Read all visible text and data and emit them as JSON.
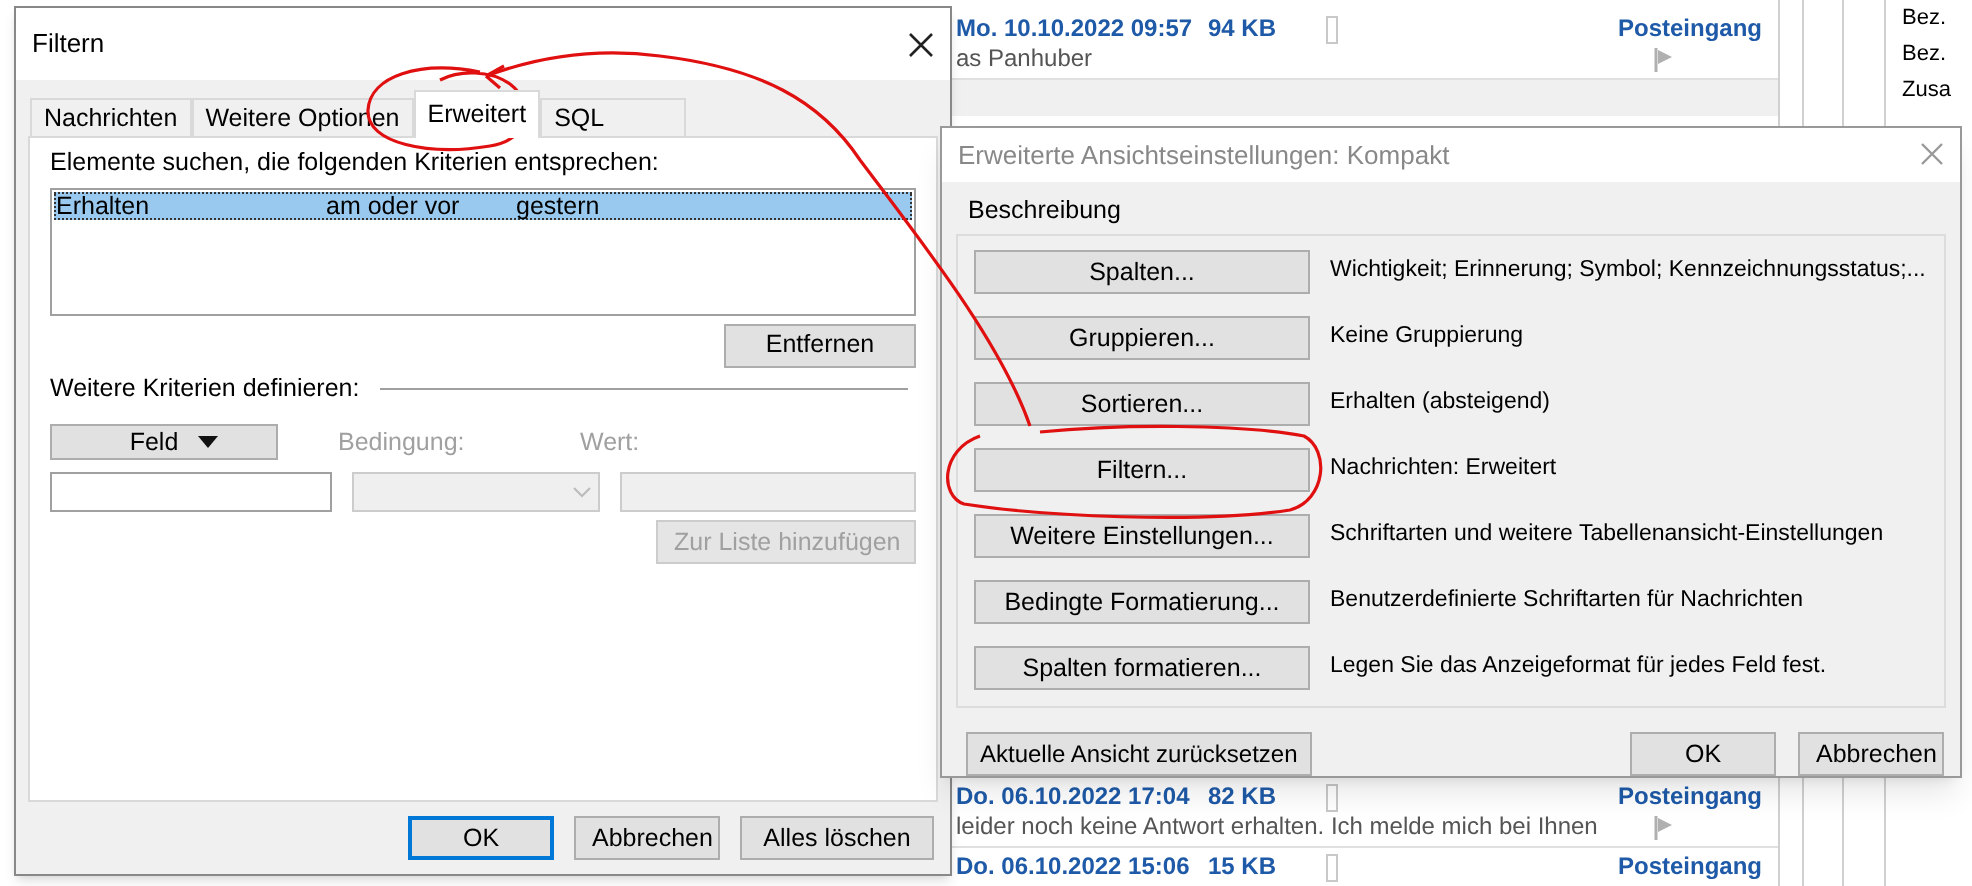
{
  "mail_list": {
    "top_row": {
      "date": "Mo. 10.10.2022 09:57",
      "size": "94 KB",
      "folder": "Posteingang",
      "preview": "as Panhuber"
    },
    "bottom_rows": [
      {
        "date": "Do. 06.10.2022 17:04",
        "size": "82 KB",
        "folder": "Posteingang",
        "preview": "leider noch keine Antwort erhalten.  Ich melde mich bei Ihnen"
      },
      {
        "date": "Do. 06.10.2022 15:06",
        "size": "15 KB",
        "folder": "Posteingang"
      }
    ]
  },
  "side_panel": {
    "lines": [
      "Bez.",
      "Bez.",
      "Zusa"
    ]
  },
  "filter_dialog": {
    "title": "Filtern",
    "tabs": [
      {
        "label": "Nachrichten",
        "selected": false
      },
      {
        "label": "Weitere Optionen",
        "selected": false
      },
      {
        "label": "Erweitert",
        "selected": true
      },
      {
        "label": "SQL",
        "selected": false
      }
    ],
    "criteria_label": "Elemente suchen, die folgenden Kriterien entsprechen:",
    "criteria": [
      {
        "field": "Erhalten",
        "condition": "am oder vor",
        "value": "gestern",
        "selected": true
      }
    ],
    "remove_button": "Entfernen",
    "more_label": "Weitere Kriterien definieren:",
    "field_button": "Feld",
    "condition": {
      "label": "Bedingung:",
      "disabled": true
    },
    "value": {
      "label": "Wert:",
      "disabled": true
    },
    "add_button": {
      "label": "Zur Liste hinzufügen",
      "disabled": true
    },
    "buttons": [
      {
        "label": "OK",
        "default": true
      },
      {
        "label": "Abbrechen",
        "default": false
      },
      {
        "label": "Alles löschen",
        "default": false
      }
    ]
  },
  "view_dialog": {
    "title": "Erweiterte Ansichtseinstellungen: Kompakt",
    "group_label": "Beschreibung",
    "rows": [
      {
        "button": "Spalten...",
        "description": "Wichtigkeit; Erinnerung; Symbol; Kennzeichnungsstatus;..."
      },
      {
        "button": "Gruppieren...",
        "description": "Keine Gruppierung"
      },
      {
        "button": "Sortieren...",
        "description": "Erhalten (absteigend)"
      },
      {
        "button": "Filtern...",
        "description": "Nachrichten: Erweitert"
      },
      {
        "button": "Weitere Einstellungen...",
        "description": "Schriftarten und weitere Tabellenansicht-Einstellungen"
      },
      {
        "button": "Bedingte Formatierung...",
        "description": "Benutzerdefinierte Schriftarten für Nachrichten"
      },
      {
        "button": "Spalten formatieren...",
        "description": "Legen Sie das Anzeigeformat für jedes Feld fest."
      }
    ],
    "reset_button": "Aktuelle Ansicht zurücksetzen",
    "buttons": [
      {
        "label": "OK",
        "default": false
      },
      {
        "label": "Abbrechen",
        "default": false
      }
    ]
  }
}
